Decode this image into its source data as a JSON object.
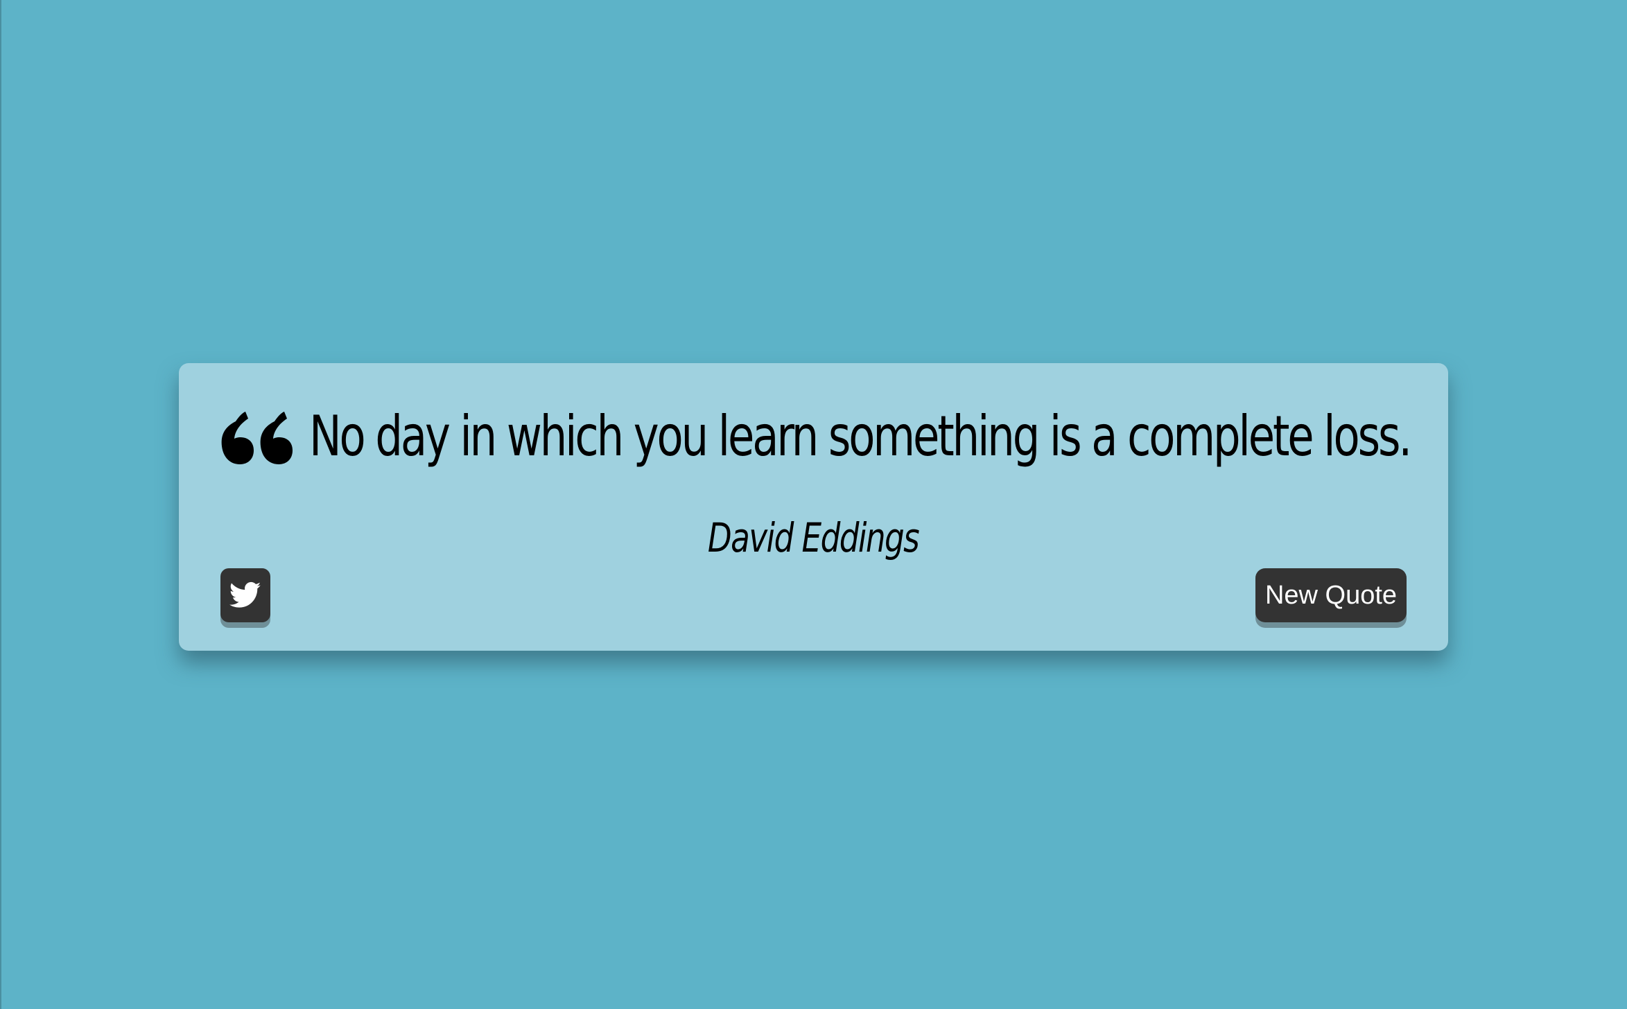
{
  "quote": {
    "text": "No day in which you learn something is a complete loss.",
    "author": "David Eddings"
  },
  "actions": {
    "tweet_icon": "twitter-icon",
    "new_quote_label": "New Quote"
  },
  "colors": {
    "background": "#5db3c8",
    "card": "#9fd1df",
    "button": "#333333"
  }
}
